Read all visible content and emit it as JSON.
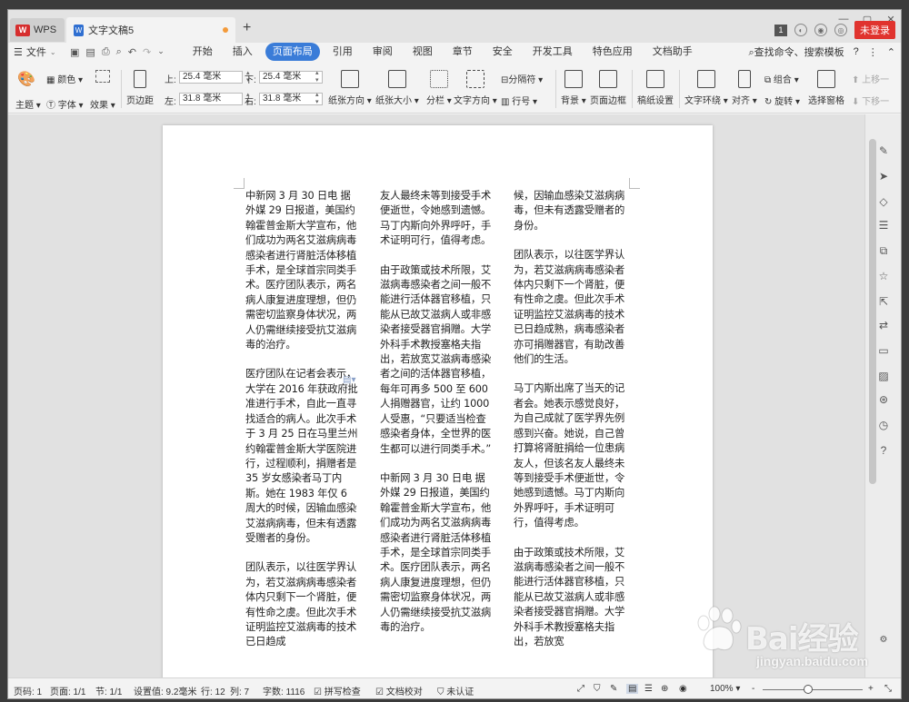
{
  "titlebar": {
    "app_name": "WPS",
    "doc_tab": "文字文稿5",
    "new_tab": "+",
    "badge": "1",
    "login": "未登录",
    "win_min": "—",
    "win_max": "▢",
    "win_close": "✕"
  },
  "menubar": {
    "file": "文件",
    "tabs": [
      "开始",
      "插入",
      "页面布局",
      "引用",
      "审阅",
      "视图",
      "章节",
      "安全",
      "开发工具",
      "特色应用",
      "文档助手"
    ],
    "active_tab": "页面布局",
    "search": "查找命令、搜索模板",
    "help": "?",
    "more": "⋮"
  },
  "toolbar": {
    "color_label": "颜色",
    "theme_label": "主题",
    "font_label": "字体",
    "effect_label": "效果",
    "margin_label": "页边距",
    "top_label": "上:",
    "top_value": "25.4 毫米",
    "left_label": "左:",
    "left_value": "31.8 毫米",
    "bottom_label": "下:",
    "bottom_value": "25.4 毫米",
    "right_label": "右:",
    "right_value": "31.8 毫米",
    "orientation_label": "纸张方向",
    "size_label": "纸张大小",
    "columns_label": "分栏",
    "text_dir_label": "文字方向",
    "break_label": "分隔符",
    "line_num_label": "行号",
    "background_label": "背景",
    "border_label": "页面边框",
    "grid_label": "稿纸设置",
    "wrap_label": "文字环绕",
    "align_label": "对齐",
    "group_label": "组合",
    "rotate_label": "旋转",
    "select_pane_label": "选择窗格",
    "up_label": "上移一",
    "down_label": "下移一"
  },
  "document": {
    "col1": [
      "中新网 3 月 30 日电 据外媒 29 日报道，美国约翰霍普金斯大学宣布，他们成功为两名艾滋病病毒感染者进行肾脏活体移植手术，是全球首宗同类手术。医疗团队表示，两名病人康复进度理想，但仍需密切监察身体状况，两人仍需继续接受抗艾滋病毒的治疗。",
      "医疗团队在记者会表示，大学在 2016 年获政府批准进行手术，自此一直寻找适合的病人。此次手术于 3 月 25 日在马里兰州约翰霍普金斯大学医院进行，过程顺利，捐赠者是 35 岁女感染者马丁内斯。她在 1983 年仅 6 周大的时候，因输血感染艾滋病病毒，但未有透露受赠者的身份。",
      "团队表示，以往医学界认为，若艾滋病病毒感染者体内只剩下一个肾脏，便有性命之虞。但此次手术证明监控艾滋病毒的技术已日趋成"
    ],
    "col2": [
      "友人最终未等到接受手术便逝世，令她感到遗憾。马丁内斯向外界呼吁，手术证明可行，值得考虑。",
      "由于政策或技术所限，艾滋病毒感染者之间一般不能进行活体器官移植，只能从已故艾滋病人或非感染者接受器官捐赠。大学外科手术教授塞格夫指出，若放宽艾滋病毒感染者之间的活体器官移植，每年可再多 500 至 600 人捐赠器官，让约 1000 人受惠，“只要适当检查感染者身体，全世界的医生都可以进行同类手术。”",
      "中新网 3 月 30 日电 据外媒 29 日报道，美国约翰霍普金斯大学宣布，他们成功为两名艾滋病病毒感染者进行肾脏活体移植手术，是全球首宗同类手术。医疗团队表示，两名病人康复进度理想，但仍需密切监察身体状况，两人仍需继续接受抗艾滋病毒的治疗。"
    ],
    "col3": [
      "候，因输血感染艾滋病病毒，但未有透露受赠者的身份。",
      "团队表示，以往医学界认为，若艾滋病病毒感染者体内只剩下一个肾脏，便有性命之虞。但此次手术证明监控艾滋病毒的技术已日趋成熟，病毒感染者亦可捐赠器官，有助改善他们的生活。",
      "马丁内斯出席了当天的记者会。她表示感觉良好，为自己成就了医学界先例感到兴奋。她说，自己曾打算将肾脏捐给一位患病友人，但该名友人最终未等到接受手术便逝世，令她感到遗憾。马丁内斯向外界呼吁，手术证明可行，值得考虑。",
      "由于政策或技术所限，艾滋病毒感染者之间一般不能进行活体器官移植，只能从已故艾滋病人或非感染者接受器官捐赠。大学外科手术教授塞格夫指出，若放宽"
    ]
  },
  "statusbar": {
    "page_num": "页码: 1",
    "pages": "页面: 1/1",
    "section": "节: 1/1",
    "setting": "设置值: 9.2毫米",
    "row": "行: 12",
    "col": "列: 7",
    "words": "字数: 1116",
    "spell": "拼写检查",
    "proof": "文档校对",
    "cert": "未认证",
    "zoom": "100%",
    "zoom_minus": "-",
    "zoom_plus": "+"
  },
  "watermark": {
    "brand": "Bai经验",
    "url": "jingyan.baidu.com"
  },
  "colors": {
    "accent": "#3a7cd8",
    "login": "#e0332e",
    "wps_red": "#d62e2e"
  }
}
